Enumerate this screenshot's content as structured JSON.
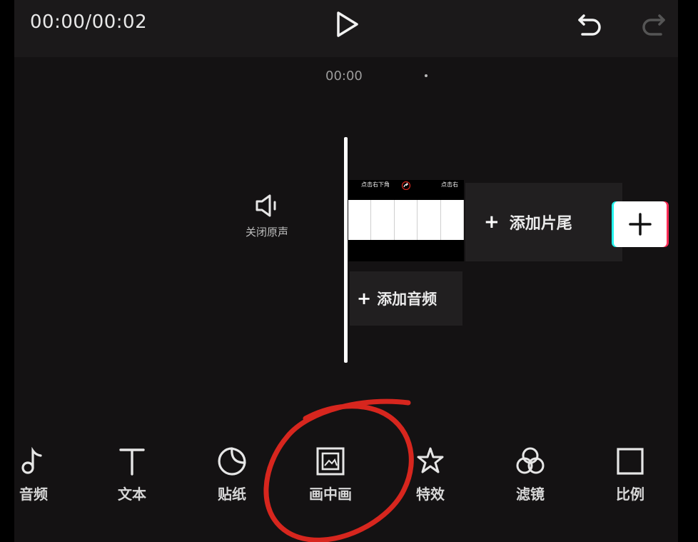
{
  "header": {
    "timecode": "00:00/00:02",
    "icons": [
      "play-icon",
      "undo-icon",
      "redo-icon"
    ]
  },
  "timeline": {
    "ruler_time": "00:00",
    "mute": {
      "label": "关闭原声",
      "icon": "speaker-mute-icon"
    },
    "clip": {
      "caption_left": "点击右下角",
      "caption_right": "点击右"
    },
    "add_ending_label": "添加片尾",
    "add_audio_label": "添加音频",
    "plus_glyph": "+"
  },
  "toolbar": {
    "items": [
      {
        "label": "音频",
        "icon": "music-note-icon"
      },
      {
        "label": "文本",
        "icon": "text-icon"
      },
      {
        "label": "贴纸",
        "icon": "sticker-icon"
      },
      {
        "label": "画中画",
        "icon": "picture-in-picture-icon"
      },
      {
        "label": "特效",
        "icon": "effects-star-icon"
      },
      {
        "label": "滤镜",
        "icon": "filter-icon"
      },
      {
        "label": "比例",
        "icon": "ratio-icon"
      }
    ]
  },
  "colors": {
    "background": "#141213",
    "topbar": "#1b191a",
    "annotation": "#d7261e",
    "accent_cyan": "#25f4ee",
    "accent_red": "#fe2c55"
  }
}
